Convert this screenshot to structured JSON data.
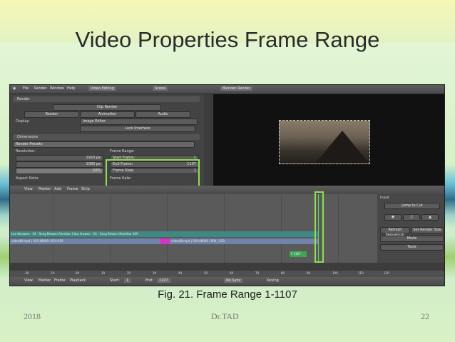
{
  "slide": {
    "title": "Video Properties Frame Range",
    "caption": "Fig. 21. Frame Range 1-1107",
    "footer_left": "2018",
    "footer_center": "Dr.TAD",
    "footer_right": "22"
  },
  "blender": {
    "top_menu": [
      "File",
      "Render",
      "Window",
      "Help",
      "Video Editing",
      "Scene",
      "Blender Render"
    ],
    "render_buttons": [
      "Clip Render",
      "Render",
      "Animation",
      "Audio"
    ],
    "display_label": "Display:",
    "display_value": "Image Editor",
    "lock_label": "Lock Interface",
    "dimensions_label": "Dimensions",
    "presets_label": "Render Presets",
    "resolution_label": "Resolution:",
    "res_x": "1920 px",
    "res_y": "1080 px",
    "res_pct": "50%",
    "aspect_label": "Aspect Ratio:",
    "frame_range_label": "Frame Range:",
    "start_frame": "Start Frame:",
    "start_value": "1",
    "end_frame": "End Frame:",
    "end_value": "1107",
    "frame_step": "Frame Step:",
    "step_value": "1",
    "frame_rate_label": "Frame Rate:",
    "view_menu": [
      "View",
      "Marker",
      "Add",
      "Frame",
      "Strip"
    ],
    "strip1": "Lee Kerawee - 24 - Song Betwen Remittar Clow Arawee - 24 - Song Betwen Remittar 009",
    "strip2": "video48-mp4 | 010:48000 / 010:420",
    "strip3": "video48 mp4 | 010:48000 / 004 | 420",
    "frame_marker": "F 1107",
    "side_title": "Input",
    "side_items": [
      "Jump to Cut",
      "Refresh Sequencer",
      "Set Render Size",
      "Mode",
      "Tools"
    ],
    "ruler_ticks": [
      "-20",
      "-10",
      "00",
      "10",
      "20",
      "30",
      "40",
      "50",
      "60",
      "70",
      "80",
      "90",
      "100",
      "110",
      "120"
    ],
    "bottom_bar": [
      "View",
      "Marker",
      "Frame",
      "Playback",
      "Start:",
      "1",
      "End:",
      "1107",
      "No Sync",
      "Keying"
    ]
  },
  "colors": {
    "highlight": "#8fe04e",
    "title": "#2a2a2a"
  }
}
